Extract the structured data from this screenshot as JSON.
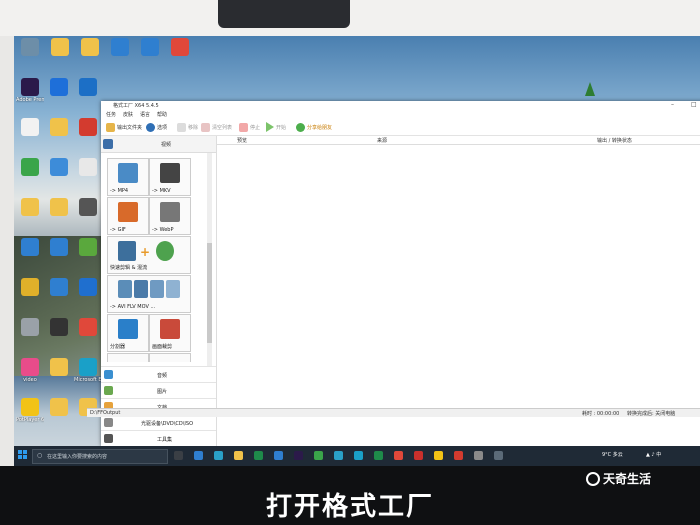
{
  "desktop": {
    "icons": [
      {
        "label": "",
        "color": "#6d8ea8"
      },
      {
        "label": "",
        "color": "#f0c24a"
      },
      {
        "label": "",
        "color": "#f0c24a"
      },
      {
        "label": "",
        "color": "#2f7fd0"
      },
      {
        "label": "",
        "color": "#2f7fd0"
      },
      {
        "label": "",
        "color": "#e0483a"
      },
      {
        "label": "Adobe Premie...",
        "color": "#2b1a4a"
      },
      {
        "label": "",
        "color": "#1e6fd9"
      },
      {
        "label": "",
        "color": "#1c6fc6"
      },
      {
        "label": "",
        "color": "#f2f2f2"
      },
      {
        "label": "",
        "color": "#f0c24a"
      },
      {
        "label": "",
        "color": "#d33b2f"
      },
      {
        "label": "",
        "color": "#3aa54a"
      },
      {
        "label": "",
        "color": "#3d8cd9"
      },
      {
        "label": "",
        "color": "#e8e8e8"
      },
      {
        "label": "",
        "color": "#f0c24a"
      },
      {
        "label": "",
        "color": "#f0c24a"
      },
      {
        "label": "",
        "color": "#555555"
      },
      {
        "label": "",
        "color": "#2f7fd0"
      },
      {
        "label": "",
        "color": "#2f7fd0"
      },
      {
        "label": "",
        "color": "#5aa83d"
      },
      {
        "label": "",
        "color": "#e0b02a"
      },
      {
        "label": "",
        "color": "#2f7fd0"
      },
      {
        "label": "",
        "color": "#1f6fcf"
      },
      {
        "label": "",
        "color": "#9aa1a8"
      },
      {
        "label": "",
        "color": "#333333"
      },
      {
        "label": "",
        "color": "#e0483a"
      },
      {
        "label": "video",
        "color": "#e84c8a"
      },
      {
        "label": "",
        "color": "#f0c24a"
      },
      {
        "label": "Microsoft Edge",
        "color": "#1aa0c8"
      },
      {
        "label": "PotPlayer 64 bit",
        "color": "#f2c316"
      },
      {
        "label": "",
        "color": "#f0c24a"
      },
      {
        "label": "",
        "color": "#f0c24a"
      }
    ]
  },
  "window": {
    "title": "格式工厂 X64 5.4.5",
    "menu": [
      "任务",
      "皮肤",
      "语言",
      "帮助"
    ],
    "toolbar": {
      "output_folder": "输出文件夹",
      "options": "选项",
      "remove": "移除",
      "clear": "清空列表",
      "stop": "停止",
      "start": "开始",
      "share": "分享给朋友"
    },
    "sidebar": {
      "header": "视频",
      "tiles": [
        {
          "caption": "-> MP4",
          "color": "#4a8bc6"
        },
        {
          "caption": "-> MKV",
          "color": "#444444"
        },
        {
          "caption": "-> GIF",
          "color": "#d86a2a"
        },
        {
          "caption": "-> WebP",
          "color": "#777777"
        }
      ],
      "wide_tiles": [
        {
          "caption": "快速剪辑 & 混流"
        },
        {
          "caption": "-> AVI FLV MOV ..."
        }
      ],
      "tiles2": [
        {
          "caption": "分割器",
          "color": "#2a7fc9"
        },
        {
          "caption": "画面裁剪",
          "color": "#c94a3a"
        }
      ],
      "categories": [
        {
          "label": "音频",
          "color": "#3a8fd0"
        },
        {
          "label": "图片",
          "color": "#6aa84f"
        },
        {
          "label": "文档",
          "color": "#e6a23c"
        },
        {
          "label": "光驱设备\\DVD\\CD\\ISO",
          "color": "#888888"
        },
        {
          "label": "工具集",
          "color": "#555555"
        }
      ]
    },
    "columns": [
      "预览",
      "来源",
      "输出 / 转换状态"
    ],
    "status": {
      "path": "D:\\FFOutput",
      "elapsed": "耗时 : 00:00:00",
      "shutdown": "转换完成后: 关闭电脑"
    }
  },
  "taskbar": {
    "search_placeholder": "在这里输入你要搜索的内容",
    "time": "9°C 多云",
    "apps": [
      {
        "color": "#3a3f45"
      },
      {
        "color": "#2f7fd0"
      },
      {
        "color": "#2aa1c8"
      },
      {
        "color": "#f0c24a"
      },
      {
        "color": "#1e8b4a"
      },
      {
        "color": "#2f7fd0"
      },
      {
        "color": "#2b1a4a"
      },
      {
        "color": "#3aa54a"
      },
      {
        "color": "#2aa1c8"
      },
      {
        "color": "#1aa0c8"
      },
      {
        "color": "#1e8b4a"
      },
      {
        "color": "#e0483a"
      },
      {
        "color": "#c9302c"
      },
      {
        "color": "#f2c316"
      },
      {
        "color": "#d33b2f"
      },
      {
        "color": "#8a8a8a"
      },
      {
        "color": "#5b6a78"
      }
    ]
  },
  "caption": "打开格式工厂",
  "watermark": "天奇生活"
}
